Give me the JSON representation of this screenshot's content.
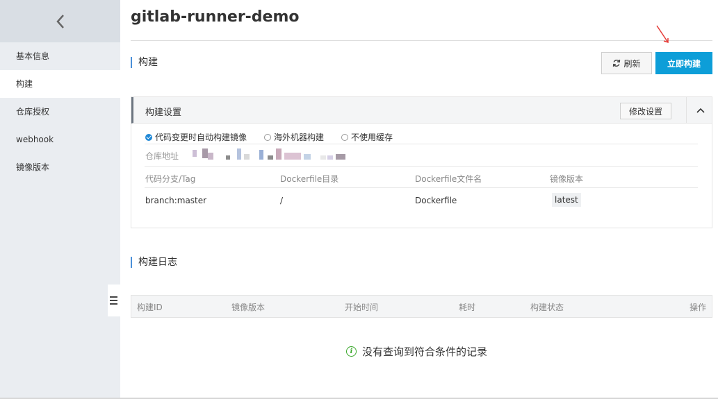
{
  "page": {
    "title": "gitlab-runner-demo"
  },
  "sidebar": {
    "back_icon": "chevron-left-icon",
    "items": [
      {
        "label": "基本信息",
        "active": false
      },
      {
        "label": "构建",
        "active": true
      },
      {
        "label": "仓库授权",
        "active": false
      },
      {
        "label": "webhook",
        "active": false
      },
      {
        "label": "镜像版本",
        "active": false
      }
    ],
    "collapse_icon": "menu-collapse-icon"
  },
  "build_section": {
    "heading": "构建",
    "refresh_label": "刷新",
    "build_now_label": "立即构建"
  },
  "build_settings": {
    "title": "构建设置",
    "modify_label": "修改设置",
    "collapse_icon": "chevron-up-icon",
    "options": [
      {
        "label": "代码变更时自动构建镜像",
        "checked": true
      },
      {
        "label": "海外机器构建",
        "checked": false
      },
      {
        "label": "不使用缓存",
        "checked": false
      }
    ],
    "repo_label": "仓库地址",
    "columns": [
      "代码分支/Tag",
      "Dockerfile目录",
      "Dockerfile文件名",
      "镜像版本"
    ],
    "row": {
      "branch": "branch:master",
      "dir": "/",
      "filename": "Dockerfile",
      "version": "latest"
    }
  },
  "build_log": {
    "heading": "构建日志",
    "columns": [
      "构建ID",
      "镜像版本",
      "开始时间",
      "耗时",
      "构建状态",
      "操作"
    ],
    "empty_message": "没有查询到符合条件的记录"
  },
  "colors": {
    "accent": "#0d9ed8",
    "sidebar_bg": "#eaedf1",
    "info_green": "#3aa82b",
    "annotation_arrow": "#e53935"
  }
}
